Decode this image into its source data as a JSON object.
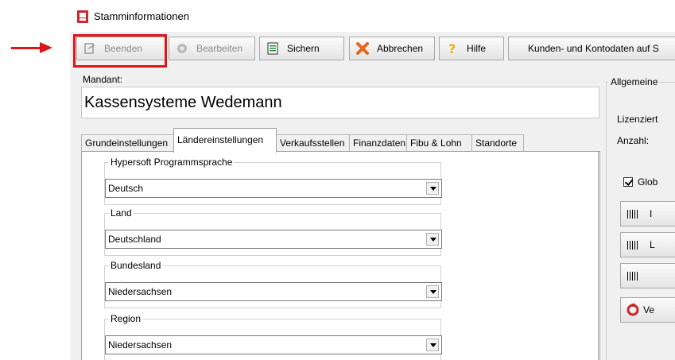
{
  "window": {
    "title": "Stamminformationen"
  },
  "toolbar": {
    "beenden": "Beenden",
    "bearbeiten": "Bearbeiten",
    "sichern": "Sichern",
    "abbrechen": "Abbrechen",
    "hilfe": "Hilfe",
    "kunden": "Kunden- und Kontodaten auf S"
  },
  "mandant": {
    "label": "Mandant:",
    "value": "Kassensysteme Wedemann"
  },
  "tabs": [
    "Grundeinstellungen",
    "Ländereinstellungen",
    "Verkaufsstellen",
    "Finanzdaten",
    "Fibu & Lohn",
    "Standorte"
  ],
  "active_tab": "Ländereinstellungen",
  "groups": [
    {
      "label": "Hypersoft Programmsprache",
      "value": "Deutsch"
    },
    {
      "label": "Land",
      "value": "Deutschland"
    },
    {
      "label": "Bundesland",
      "value": "Niedersachsen"
    },
    {
      "label": "Region",
      "value": "Niedersachsen"
    }
  ],
  "right_panel": {
    "group_title": "Allgemeine",
    "lizenziert": "Lizenziert",
    "anzahl": "Anzahl:",
    "checkbox_label": "Glob",
    "button1_label": "I",
    "button2_label": "L",
    "button3_label": "",
    "button4_label": "Ve"
  },
  "colors": {
    "highlight": "#e3131a",
    "app_icon": "#c8282e"
  }
}
